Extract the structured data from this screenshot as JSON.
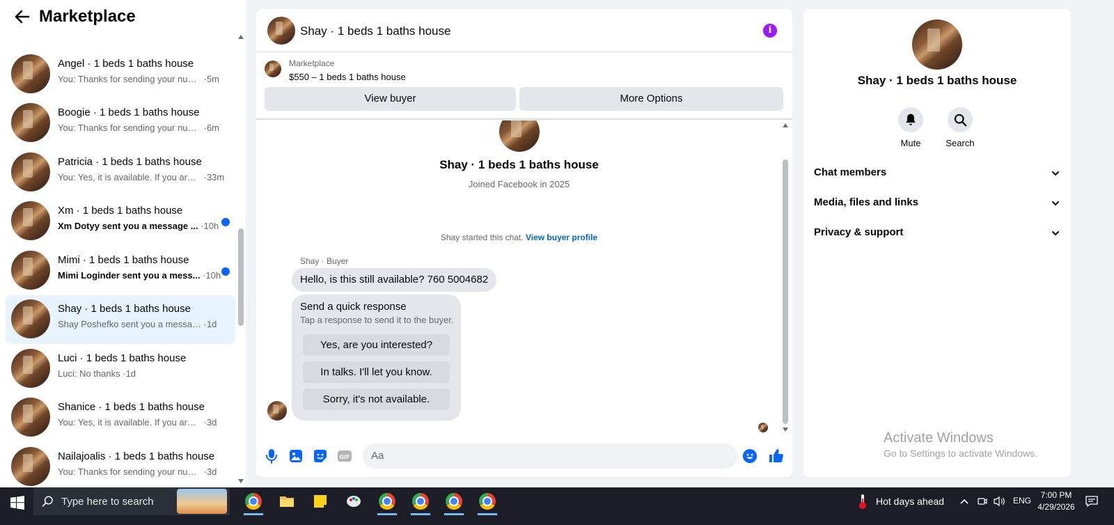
{
  "left": {
    "title": "Marketplace",
    "conversations": [
      {
        "name": "",
        "preview": "You: Thanks for sending your num...",
        "time": "5m",
        "unread": false,
        "active": false
      },
      {
        "name": "Angel · 1 beds 1 baths house",
        "preview": "You: Thanks for sending your num...",
        "time": "5m",
        "unread": false,
        "active": false
      },
      {
        "name": "Boogie · 1 beds 1 baths house",
        "preview": "You: Thanks for sending your num...",
        "time": "6m",
        "unread": false,
        "active": false
      },
      {
        "name": "Patricia · 1 beds 1 baths house",
        "preview": "You: Yes, it is available. If you are i...",
        "time": "33m",
        "unread": false,
        "active": false
      },
      {
        "name": "Xm · 1 beds 1 baths house",
        "preview": "Xm Dotyy sent you a message ...",
        "time": "10h",
        "unread": true,
        "active": false
      },
      {
        "name": "Mimi · 1 beds 1 baths house",
        "preview": "Mimi Loginder sent you a mess...",
        "time": "10h",
        "unread": true,
        "active": false
      },
      {
        "name": "Shay · 1 beds 1 baths house",
        "preview": "Shay Poshefko sent you a message ...",
        "time": "1d",
        "unread": false,
        "active": true
      },
      {
        "name": "Luci · 1 beds 1 baths house",
        "preview": "Luci: No thanks",
        "time": "1d",
        "unread": false,
        "active": false
      },
      {
        "name": "Shanice · 1 beds 1 baths house",
        "preview": "You: Yes, it is available. If you are int...",
        "time": "3d",
        "unread": false,
        "active": false
      },
      {
        "name": "Nailajoalis · 1 beds 1 baths house",
        "preview": "You: Thanks for sending your numb...",
        "time": "3d",
        "unread": false,
        "active": false
      }
    ]
  },
  "chat": {
    "title": "Shay · 1 beds 1 baths house",
    "listing_source": "Marketplace",
    "listing_title": "$550 – 1 beds 1 baths house",
    "view_buyer_label": "View buyer",
    "more_options_label": "More Options",
    "profile_name": "Shay · 1 beds 1 baths house",
    "profile_joined": "Joined Facebook in 2025",
    "started_text": "Shay started this chat.",
    "started_link": "View buyer profile",
    "sender_label": "Shay · Buyer",
    "message": "Hello, is this still available? 760 5004682",
    "quick_title": "Send a quick response",
    "quick_subtitle": "Tap a response to send it to the buyer.",
    "quick_responses": [
      "Yes, are you interested?",
      "In talks. I'll let you know.",
      "Sorry, it's not available."
    ],
    "input_placeholder": "Aa"
  },
  "right": {
    "name": "Shay · 1 beds 1 baths house",
    "mute_label": "Mute",
    "search_label": "Search",
    "sections": [
      "Chat members",
      "Media, files and links",
      "Privacy & support"
    ],
    "activate_line1": "Activate Windows",
    "activate_line2": "Go to Settings to activate Windows."
  },
  "taskbar": {
    "search_text": "Type here to search",
    "weather": "Hot days ahead",
    "language": "ENG",
    "time": "7:00 PM",
    "date": "4/29/2026"
  },
  "colors": {
    "accent": "#0866ff",
    "active_row": "#e7f3ff",
    "info_icon": "#9a1bff"
  }
}
